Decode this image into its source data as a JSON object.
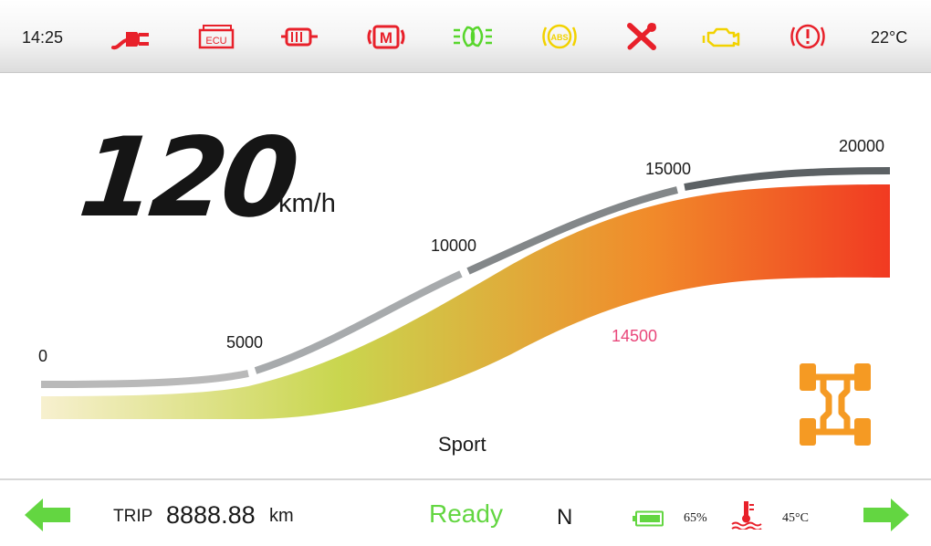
{
  "status_bar": {
    "time": "14:25",
    "outside_temp": "22°C",
    "indicators": [
      {
        "icon": "charging-plug-icon",
        "color": "#e8202a"
      },
      {
        "icon": "ecu-fault-icon",
        "label": "ECU",
        "color": "#e8202a"
      },
      {
        "icon": "motor-overheat-icon",
        "color": "#e8202a"
      },
      {
        "icon": "motor-fault-icon",
        "label": "M",
        "color": "#e8202a"
      },
      {
        "icon": "low-beam-headlight-icon",
        "color": "#58d62c"
      },
      {
        "icon": "abs-warning-icon",
        "label": "ABS",
        "color": "#f2d200"
      },
      {
        "icon": "service-wrench-icon",
        "color": "#e8202a"
      },
      {
        "icon": "check-engine-icon",
        "color": "#f2d200"
      },
      {
        "icon": "brake-warning-icon",
        "color": "#e8202a"
      }
    ]
  },
  "speed": {
    "value": "120",
    "unit": "km/h"
  },
  "rpm_gauge": {
    "ticks": [
      "0",
      "5000",
      "10000",
      "15000",
      "20000"
    ],
    "current_value": "14500",
    "current_fraction": 0.725,
    "gradient_colors": [
      "#f7f0cf",
      "#c9d64f",
      "#f18a2a",
      "#f13a22"
    ]
  },
  "drive_mode": "Sport",
  "drive_icon": {
    "icon": "all-wheel-drive-icon",
    "color": "#f59a23"
  },
  "bottom_bar": {
    "left_arrow": {
      "icon": "left-turn-signal-icon",
      "color": "#63d641"
    },
    "right_arrow": {
      "icon": "right-turn-signal-icon",
      "color": "#63d641"
    },
    "trip": {
      "label": "TRIP",
      "value": "8888.88",
      "unit": "km"
    },
    "status": "Ready",
    "gear": "N",
    "battery": {
      "icon": "battery-icon",
      "value": "65%",
      "color": "#63d641"
    },
    "coolant": {
      "icon": "coolant-temperature-icon",
      "value": "45°C",
      "color": "#e8202a"
    }
  }
}
